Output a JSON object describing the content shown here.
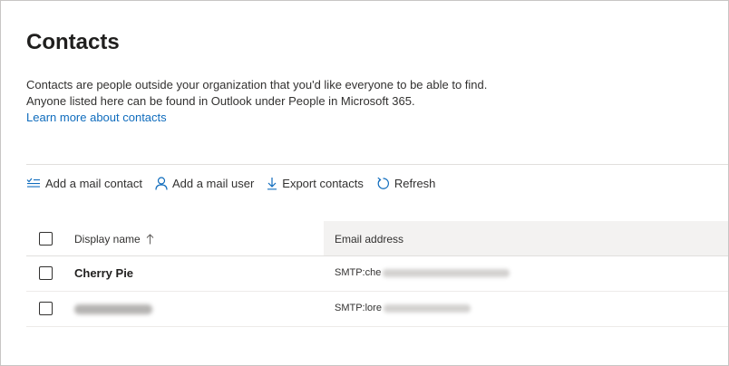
{
  "page": {
    "title": "Contacts",
    "description_line1": "Contacts are people outside your organization that you'd like everyone to be able to find.",
    "description_line2": "Anyone listed here can be found in Outlook under People in Microsoft 365.",
    "learn_more_link": "Learn more about contacts"
  },
  "toolbar": {
    "add_mail_contact": "Add a mail contact",
    "add_mail_user": "Add a mail user",
    "export_contacts": "Export contacts",
    "refresh": "Refresh"
  },
  "table": {
    "columns": {
      "display_name": "Display name",
      "email_address": "Email address"
    },
    "sort": {
      "column": "Display name",
      "direction": "ascending"
    },
    "rows": [
      {
        "display_name": "Cherry Pie",
        "email_prefix": "SMTP:che",
        "name_redacted": false
      },
      {
        "display_name": "",
        "email_prefix": "SMTP:lore",
        "name_redacted": true
      }
    ]
  },
  "colors": {
    "accent": "#0f6cbd",
    "text": "#323130",
    "header_highlight": "#f3f2f1"
  }
}
